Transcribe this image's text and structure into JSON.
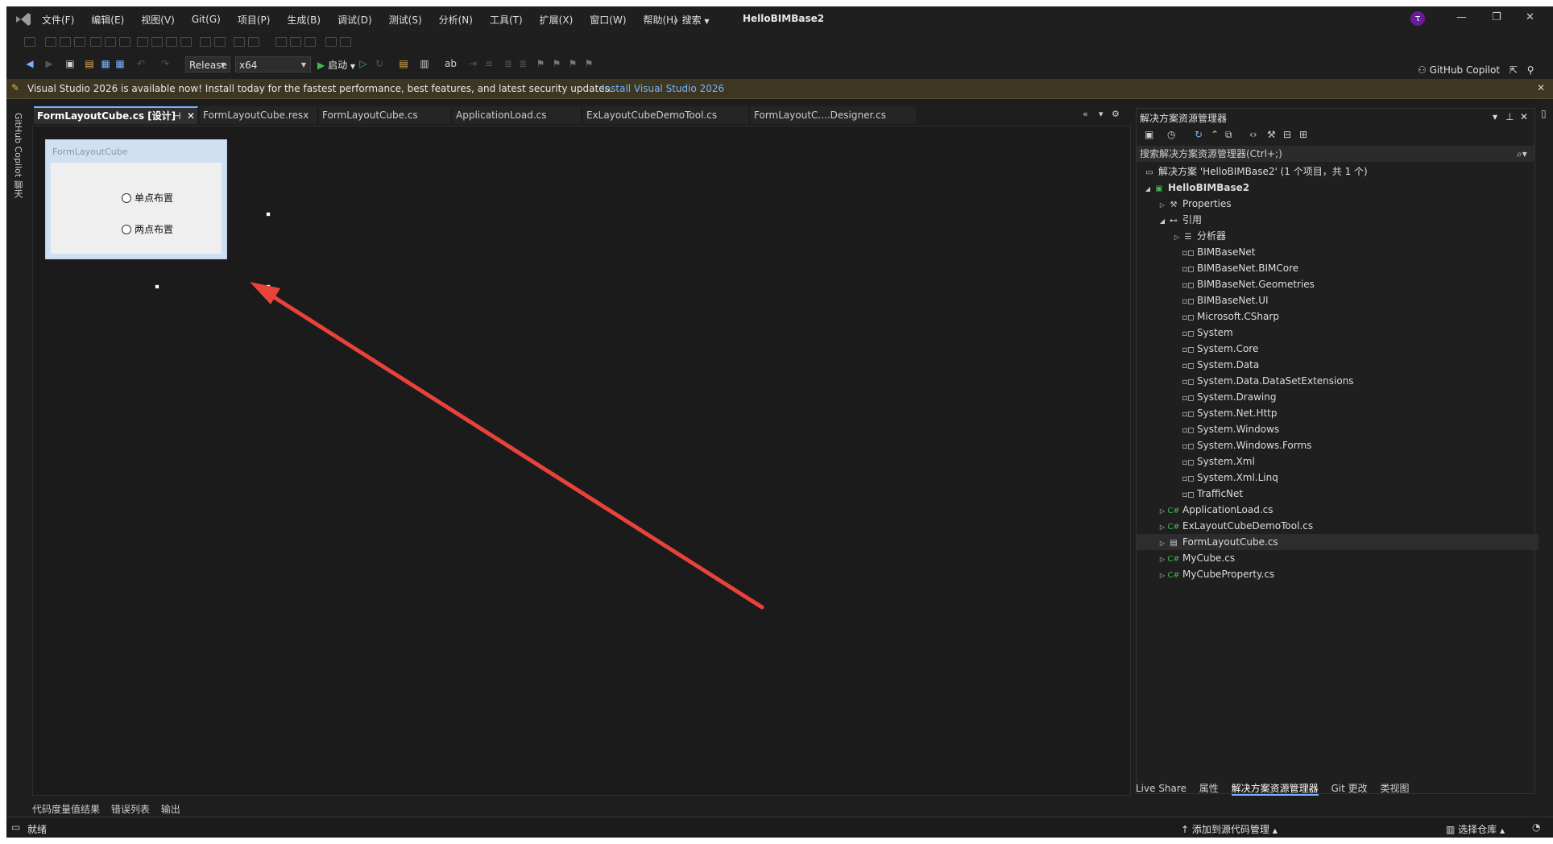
{
  "titlebar": {
    "menus": [
      "文件(F)",
      "编辑(E)",
      "视图(V)",
      "Git(G)",
      "项目(P)",
      "生成(B)",
      "调试(D)",
      "测试(S)",
      "分析(N)",
      "工具(T)",
      "扩展(X)",
      "窗口(W)",
      "帮助(H)"
    ],
    "search": "搜索",
    "solution_name": "HelloBIMBase2",
    "avatar_letter": "τ"
  },
  "toolbar": {
    "configuration": "Release",
    "platform": "x64",
    "start_label": "启动",
    "copilot_label": "GitHub Copilot"
  },
  "notification": {
    "message": "Visual Studio 2026 is available now! Install today for the fastest performance, best features, and latest security updates.",
    "link": "Install Visual Studio 2026"
  },
  "left_rail": {
    "label": "GitHub Copilot 聊天"
  },
  "tabs": [
    {
      "label": "FormLayoutCube.cs [设计]"
    },
    {
      "label": "FormLayoutCube.resx"
    },
    {
      "label": "FormLayoutCube.cs"
    },
    {
      "label": "ApplicationLoad.cs"
    },
    {
      "label": "ExLayoutCubeDemoTool.cs"
    },
    {
      "label": "FormLayoutC....Designer.cs"
    }
  ],
  "designer": {
    "form_title": "FormLayoutCube",
    "radio1": "单点布置",
    "radio2": "两点布置"
  },
  "solution_explorer": {
    "title": "解决方案资源管理器",
    "search_placeholder": "搜索解决方案资源管理器(Ctrl+;)",
    "tree": [
      {
        "label": "解决方案 'HelloBIMBase2' (1 个项目，共 1 个)",
        "icon": "solution-icon"
      },
      {
        "label": "HelloBIMBase2",
        "icon": "csharp-project-icon"
      },
      {
        "label": "Properties",
        "icon": "wrench-icon"
      },
      {
        "label": "引用",
        "icon": "references-icon"
      },
      {
        "label": "分析器",
        "icon": "analyzer-icon"
      },
      {
        "label": "BIMBaseNet",
        "icon": "reference-icon"
      },
      {
        "label": "BIMBaseNet.BIMCore",
        "icon": "reference-icon"
      },
      {
        "label": "BIMBaseNet.Geometries",
        "icon": "reference-icon"
      },
      {
        "label": "BIMBaseNet.UI",
        "icon": "reference-icon"
      },
      {
        "label": "Microsoft.CSharp",
        "icon": "reference-icon"
      },
      {
        "label": "System",
        "icon": "reference-icon"
      },
      {
        "label": "System.Core",
        "icon": "reference-icon"
      },
      {
        "label": "System.Data",
        "icon": "reference-icon"
      },
      {
        "label": "System.Data.DataSetExtensions",
        "icon": "reference-icon"
      },
      {
        "label": "System.Drawing",
        "icon": "reference-icon"
      },
      {
        "label": "System.Net.Http",
        "icon": "reference-icon"
      },
      {
        "label": "System.Windows",
        "icon": "reference-icon"
      },
      {
        "label": "System.Windows.Forms",
        "icon": "reference-icon"
      },
      {
        "label": "System.Xml",
        "icon": "reference-icon"
      },
      {
        "label": "System.Xml.Linq",
        "icon": "reference-icon"
      },
      {
        "label": "TrafficNet",
        "icon": "reference-icon"
      },
      {
        "label": "ApplicationLoad.cs",
        "icon": "csharp-file-icon"
      },
      {
        "label": "ExLayoutCubeDemoTool.cs",
        "icon": "csharp-file-icon"
      },
      {
        "label": "FormLayoutCube.cs",
        "icon": "form-file-icon"
      },
      {
        "label": "MyCube.cs",
        "icon": "csharp-file-icon"
      },
      {
        "label": "MyCubeProperty.cs",
        "icon": "csharp-file-icon"
      }
    ],
    "bottom_tabs": [
      "Live Share",
      "属性",
      "解决方案资源管理器",
      "Git 更改",
      "类视图"
    ]
  },
  "bottom_tabs": [
    "代码度量值结果",
    "错误列表",
    "输出"
  ],
  "status": {
    "ready": "就绪",
    "add_source_control": "添加到源代码管理",
    "select_repo": "选择仓库"
  },
  "colors": {
    "arrow": "#e8423a",
    "accent": "#7ab0ff"
  }
}
